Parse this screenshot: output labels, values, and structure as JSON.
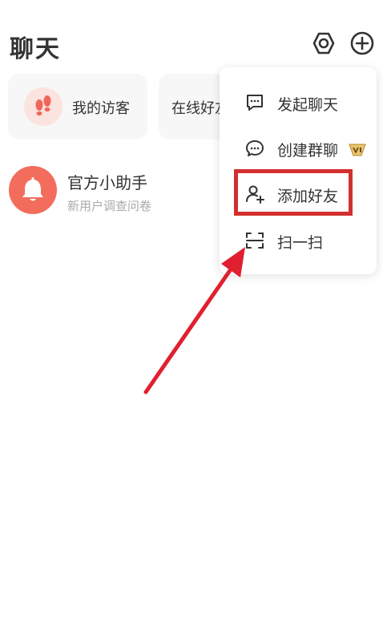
{
  "header": {
    "title": "聊天",
    "icons": [
      "settings-icon",
      "add-icon"
    ]
  },
  "quick_cards": [
    {
      "label": "我的访客",
      "icon": "footprints-icon"
    },
    {
      "label": "在线好友"
    }
  ],
  "chats": [
    {
      "name": "官方小助手",
      "preview": "新用户调查问卷",
      "icon": "bell-icon"
    }
  ],
  "menu": {
    "items": [
      {
        "label": "发起聊天",
        "icon": "chat-bubble-icon"
      },
      {
        "label": "创建群聊",
        "icon": "group-chat-icon",
        "badge": "vip-badge-icon"
      },
      {
        "label": "添加好友",
        "icon": "add-friend-icon"
      },
      {
        "label": "扫一扫",
        "icon": "scan-icon"
      }
    ]
  },
  "annotation": {
    "highlight_color": "#d32f2f",
    "arrow_color": "#e02030"
  },
  "colors": {
    "accent": "#f26d5c",
    "card_bg": "#f7f7f7"
  }
}
